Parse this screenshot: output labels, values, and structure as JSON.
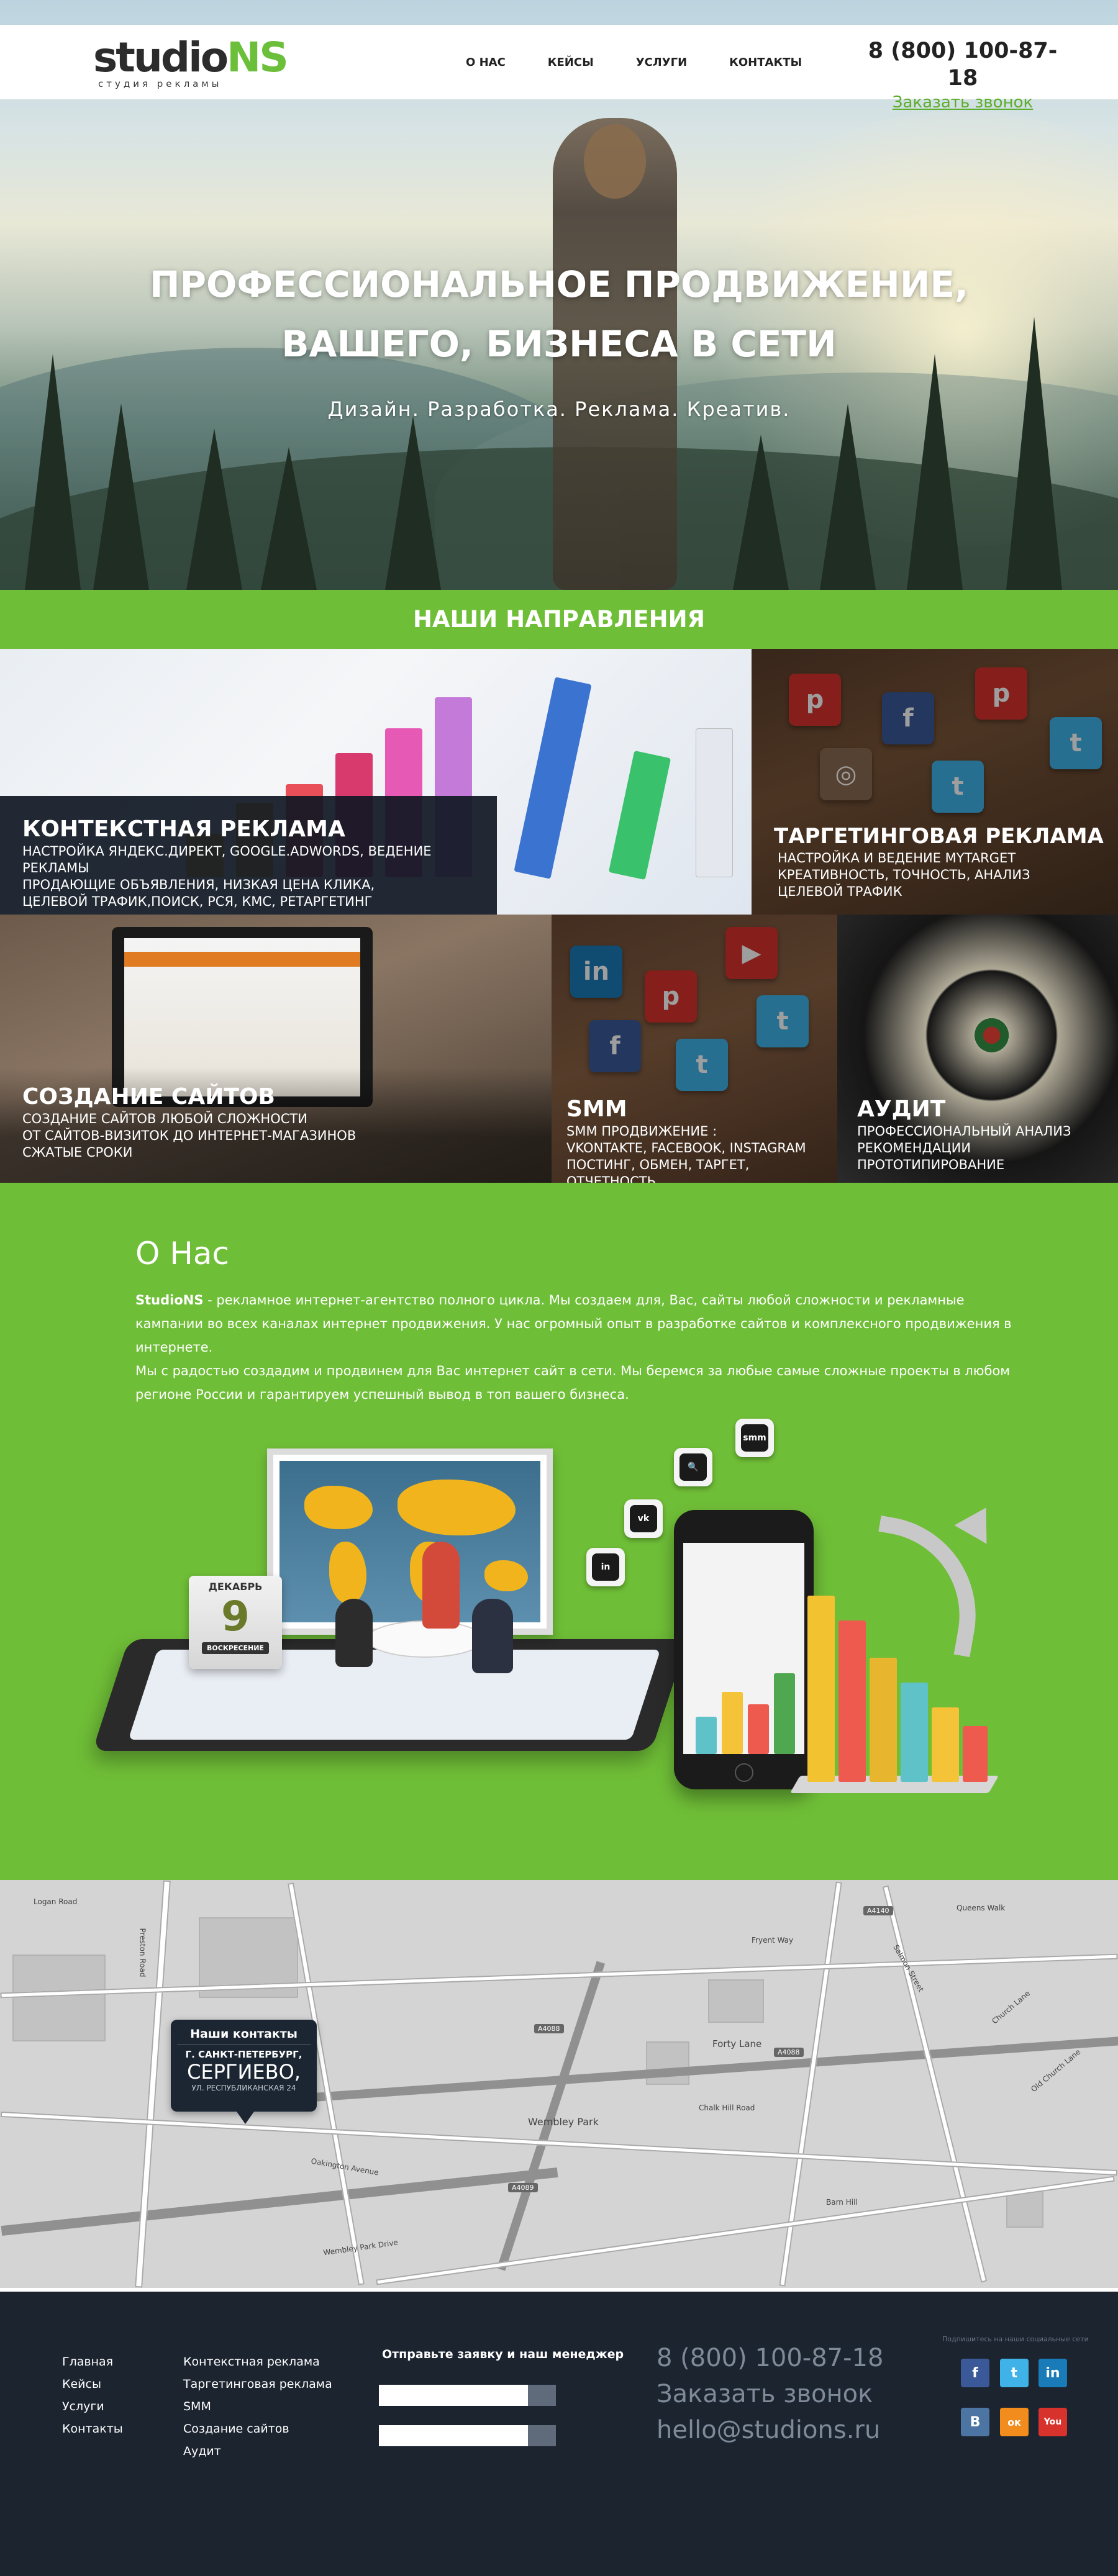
{
  "header": {
    "logo_main_a": "studio",
    "logo_main_b": "NS",
    "logo_sub": "студия рекламы",
    "nav": [
      "О НАС",
      "КЕЙСЫ",
      "УСЛУГИ",
      "КОНТАКТЫ"
    ],
    "phone": "8 (800) 100-87-18",
    "callback": "Заказать звонок"
  },
  "hero": {
    "title_line1": "ПРОФЕССИОНАЛЬНОЕ ПРОДВИЖЕНИЕ,",
    "title_line2": "ВАШЕГО, БИЗНЕСА В СЕТИ",
    "subtitle": "Дизайн. Разработка. Реклама. Креатив."
  },
  "directions": {
    "title": "НАШИ НАПРАВЛЕНИЯ",
    "tiles": [
      {
        "title": "КОНТЕКСТНАЯ РЕКЛАМА",
        "lines": [
          "НАСТРОЙКА ЯНДЕКС.ДИРЕКТ, GOOGLE.ADWORDS, ВЕДЕНИЕ РЕКЛАМЫ",
          "ПРОДАЮЩИЕ ОБЪЯВЛЕНИЯ, НИЗКАЯ ЦЕНА КЛИКА,",
          "ЦЕЛЕВОЙ ТРАФИК,ПОИСК, РСЯ, КМС, РЕТАРГЕТИНГ"
        ]
      },
      {
        "title": "ТАРГЕТИНГОВАЯ РЕКЛАМА",
        "lines": [
          "НАСТРОЙКА И ВЕДЕНИЕ MYTARGET",
          "КРЕАТИВНОСТЬ, ТОЧНОСТЬ, АНАЛИЗ",
          "ЦЕЛЕВОЙ ТРАФИК"
        ]
      },
      {
        "title": "СОЗДАНИЕ САЙТОВ",
        "lines": [
          "СОЗДАНИЕ САЙТОВ ЛЮБОЙ СЛОЖНОСТИ",
          "ОТ САЙТОВ-ВИЗИТОК ДО ИНТЕРНЕТ-МАГАЗИНОВ",
          "СЖАТЫЕ СРОКИ"
        ]
      },
      {
        "title": "SMM",
        "lines": [
          "SMM ПРОДВИЖЕНИЕ :",
          "VKONTAKTE, FACEBOOK, INSTAGRAM",
          "ПОСТИНГ, ОБМЕН, ТАРГЕТ, ОТЧЕТНОСТЬ"
        ]
      },
      {
        "title": "АУДИТ",
        "lines": [
          "ПРОФЕССИОНАЛЬНЫЙ АНАЛИЗ",
          "РЕКОМЕНДАЦИИ",
          "ПРОТОТИПИРОВАНИЕ"
        ]
      }
    ]
  },
  "about": {
    "title": "О Нас",
    "brand": "StudioNS",
    "p1_rest": " - рекламное интернет-агентство  полного цикла. Мы создаем для, Вас, сайты любой сложности и рекламные кампании во всех каналах интернет продвижения. У нас огромный опыт в разработке сайтов и комплексного продвижения в интернете.",
    "p2": "Мы с радостью создадим и продвинем для Вас интернет сайт в сети. Мы беремся за любые самые сложные проекты в любом регионе России и гарантируем успешный вывод в топ вашего бизнеса.",
    "calendar_month": "ДЕКАБРЬ",
    "calendar_day": "9",
    "calendar_weekday": "ВОСКРЕСЕНИЕ",
    "keys": [
      "smm",
      "in",
      "vk",
      "🔍"
    ]
  },
  "map": {
    "card_title": "Наши контакты",
    "card_city": "Г. САНКТ-ПЕТЕРБУРГ,",
    "card_place": "СЕРГИЕВО,",
    "card_street": "УЛ. РЕСПУБЛИКАНСКАЯ 24",
    "labels": [
      "Logan Road",
      "Preston Road",
      "Wembley Park",
      "Forty Lane",
      "Chalk Hill Road",
      "A4088",
      "A4140",
      "A4089",
      "Church Lane",
      "Barn Hill",
      "Wembley Park Drive",
      "Oakington Avenue",
      "Queens Walk",
      "Salmon Street",
      "Fryent Way",
      "Old Church Lane"
    ]
  },
  "footer": {
    "nav": [
      "Главная",
      "Кейсы",
      "Услуги",
      "Контакты"
    ],
    "services": [
      "Контекстная реклама",
      "Таргетинговая реклама",
      "SMM",
      "Создание сайтов",
      "Аудит"
    ],
    "form_title": "Отправьте заявку и наш менеджер",
    "phone": "8 (800) 100-87-18",
    "callback": "Заказать звонок",
    "email": "hello@studions.ru",
    "social_note": "Подпишитесь на наши социальные сети",
    "social": [
      {
        "name": "facebook",
        "glyph": "f",
        "color": "#3b5998"
      },
      {
        "name": "twitter",
        "glyph": "t",
        "color": "#3fb3e8"
      },
      {
        "name": "linkedin",
        "glyph": "in",
        "color": "#1a7bb9"
      },
      {
        "name": "vkontakte",
        "glyph": "В",
        "color": "#4c75a3"
      },
      {
        "name": "odnoklassniki",
        "glyph": "ок",
        "color": "#f28c1c"
      },
      {
        "name": "youtube",
        "glyph": "You",
        "color": "#d8322c"
      }
    ]
  },
  "colors": {
    "accent": "#6fbe37",
    "dark": "#1c2430",
    "link": "#5cae2b"
  }
}
